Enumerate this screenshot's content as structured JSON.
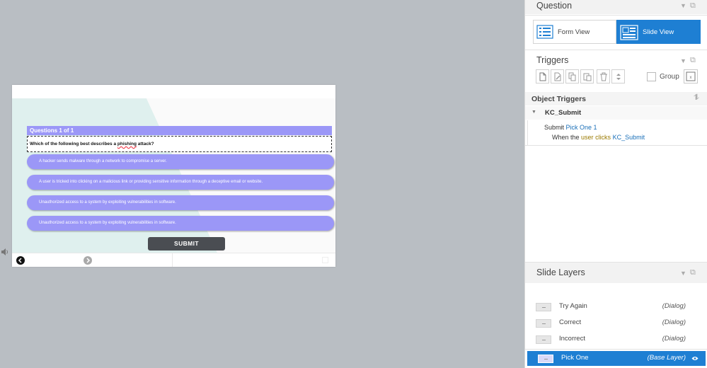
{
  "slide": {
    "question_header": "Questions 1 of 1",
    "question_text_before": "Which of the following best describes a ",
    "question_text_word": "phishing",
    "question_text_after": " attack?",
    "choices": [
      "A hacker sends malware through a network to compromise a server.",
      "A user is tricked into clicking on a malicious link or providing sensitive information through a deceptive email or website.",
      "Unauthorized access to a system by exploiting vulnerabilities in software.",
      "Unauthorized access to a system by exploiting vulnerabilities in software."
    ],
    "submit_label": "SUBMIT",
    "colors": {
      "choice": "#9b97f7",
      "header": "#9b97f7",
      "submit": "#4a4d52",
      "bg_shape": "#dff0ee"
    }
  },
  "question_panel": {
    "title": "Question",
    "form_view_label": "Form View",
    "slide_view_label": "Slide View",
    "active_view": "Slide View"
  },
  "triggers_panel": {
    "title": "Triggers",
    "group_label": "Group",
    "toolbar_icons": [
      "new-trigger-icon",
      "edit-trigger-icon",
      "copy-icon",
      "paste-icon",
      "delete-icon",
      "move-up-down-icon"
    ]
  },
  "object_triggers": {
    "title": "Object Triggers",
    "object_name": "KC_Submit",
    "action_word": "Submit",
    "action_target": "Pick One 1",
    "when_prefix": "When the ",
    "when_user": "user",
    "when_verb": "clicks",
    "when_object": "KC_Submit"
  },
  "slide_layers": {
    "title": "Slide Layers",
    "layers": [
      {
        "name": "Try Again",
        "type": "(Dialog)"
      },
      {
        "name": "Correct",
        "type": "(Dialog)"
      },
      {
        "name": "Incorrect",
        "type": "(Dialog)"
      },
      {
        "name": "Pick One",
        "type": "(Base Layer)",
        "active": true
      }
    ]
  },
  "accent_color": "#1e7fd3"
}
